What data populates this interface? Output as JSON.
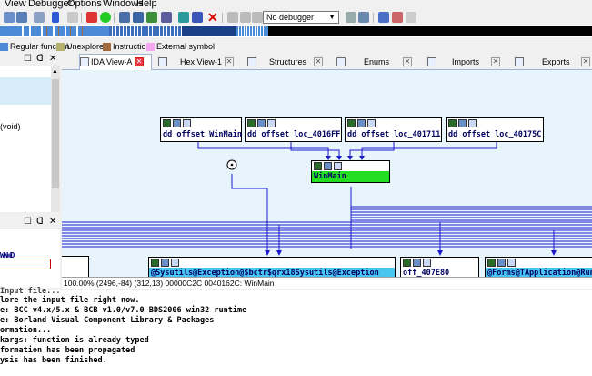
{
  "menu": [
    "View",
    "Debugger",
    "Options",
    "Windows",
    "Help"
  ],
  "toolbar": {
    "debugger_select": "No debugger"
  },
  "legend": [
    {
      "label": "Regular function",
      "color": "#4b8ad6"
    },
    {
      "label": "Unexplored",
      "color": "#b5b06b"
    },
    {
      "label": "Instruction",
      "color": "#a46a3f"
    },
    {
      "label": "External symbol",
      "color": "#f7a6f2"
    }
  ],
  "left_panel": {
    "void_text": "(void)",
    "fragment_text": "WWWD"
  },
  "tabs": [
    {
      "label": "IDA View-A"
    },
    {
      "label": "Hex View-1"
    },
    {
      "label": "Structures"
    },
    {
      "label": "Enums"
    },
    {
      "label": "Imports"
    },
    {
      "label": "Exports"
    }
  ],
  "graph": {
    "nodes": {
      "n1": "dd offset WinMain",
      "n2": "dd offset loc_4016FF",
      "n3": "dd offset loc_401711",
      "n4": "dd offset loc_40175C",
      "winmain": "WinMain",
      "b1": "@Sysutils@Exception@$bctr$qrx18Sysutils@Exception",
      "b2": "off_407E80",
      "b3": "@Forms@TApplication@Run"
    },
    "status": "100.00% (2496,-84) (312,13) 00000C2C 0040162C: WinMain"
  },
  "output": [
    "Input file...",
    "lore the input file right now.",
    "e: BCC v4.x/5.x & BCB v1.0/v7.0 BDS2006 win32 runtime",
    "e: Borland Visual Component Library & Packages",
    "ormation...",
    "kargs: function is already typed",
    "formation has been propagated",
    "ysis has been finished."
  ],
  "colors": {
    "graph_bg": "#e8f4fb",
    "edge": "#1a1acc",
    "highlight": "#22dd22"
  }
}
